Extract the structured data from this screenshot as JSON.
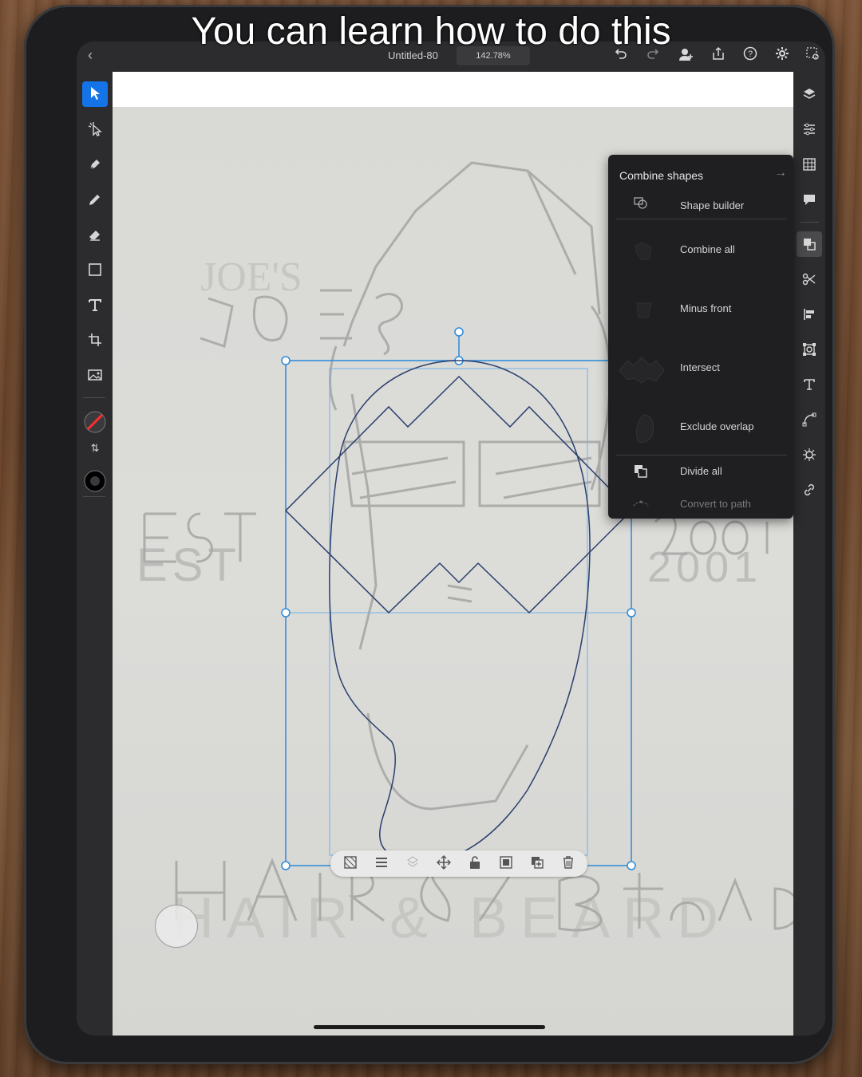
{
  "caption": "You can learn how to do this",
  "topbar": {
    "doc_title": "Untitled-80",
    "zoom": "142.78%",
    "icons": [
      "back-icon",
      "undo-icon",
      "redo-icon",
      "add-user-icon",
      "share-icon",
      "help-icon",
      "settings-icon",
      "shape-select-icon"
    ]
  },
  "left_toolbar": {
    "tools": [
      "select-icon",
      "direct-select-icon",
      "pen-icon",
      "pencil-icon",
      "eraser-icon",
      "rectangle-icon",
      "text-icon",
      "crop-icon",
      "image-icon"
    ],
    "stroke_color": "#ff2d2d",
    "fill_color": "#000000"
  },
  "right_toolbar": {
    "tools": [
      "layers-icon",
      "properties-icon",
      "swatches-icon",
      "comments-icon",
      "combine-shapes-icon",
      "scissors-icon",
      "align-icon",
      "transform-icon",
      "type-icon",
      "path-icon",
      "repeat-icon",
      "link-icon"
    ]
  },
  "combine_panel": {
    "title": "Combine shapes",
    "items": [
      {
        "label": "Shape builder"
      },
      {
        "label": "Combine all"
      },
      {
        "label": "Minus front"
      },
      {
        "label": "Intersect"
      },
      {
        "label": "Exclude overlap"
      },
      {
        "label": "Divide all"
      },
      {
        "label": "Convert to path"
      }
    ]
  },
  "sketch_text": {
    "top": "JOE'S",
    "left": "EST",
    "right": "2001",
    "bottom": "HAIR & BEARD"
  },
  "context_bar": {
    "icons": [
      "mask-icon",
      "align-menu-icon",
      "arrange-icon",
      "move-icon",
      "lock-icon",
      "group-icon",
      "duplicate-icon",
      "delete-icon"
    ]
  },
  "colors": {
    "accent": "#1473e6",
    "selection": "#2b8ad9",
    "path": "#2a3f6d"
  }
}
